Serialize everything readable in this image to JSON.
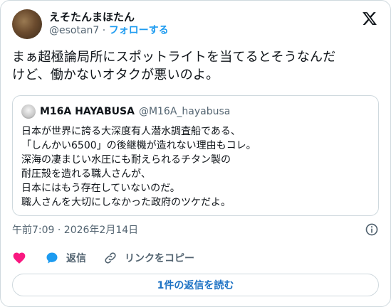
{
  "tweet": {
    "display_name": "えそたんまほたん",
    "handle": "@esotan7",
    "separator": "·",
    "follow_label": "フォローする",
    "text": "まぁ超極論局所にスポットライトを当てるとそうなんだ\nけど、働かないオタクが悪いのよ。",
    "timestamp": "午前7:09 · 2026年2月14日"
  },
  "quote": {
    "display_name": "M16A HAYABUSA",
    "handle": "@M16A_hayabusa",
    "text": "日本が世界に誇る大深度有人潜水調査船である、\n「しんかい6500」の後継機が造れない理由もコレ。\n深海の凄まじい水圧にも耐えられるチタン製の\n耐圧殻を造れる職人さんが、\n日本にはもう存在していないのだ。\n職人さんを大切にしなかった政府のツケだよ。"
  },
  "actions": {
    "reply_label": "返信",
    "copy_link_label": "リンクをコピー"
  },
  "read_replies_label": "1件の返信を読む",
  "icons": {
    "logo": "x-logo-icon",
    "info": "info-icon",
    "like": "heart-icon",
    "reply": "speech-bubble-icon",
    "link": "link-icon"
  },
  "colors": {
    "accent": "#1d9bf0",
    "like": "#f91880",
    "border": "#cfd9de",
    "secondary_text": "#536471"
  }
}
